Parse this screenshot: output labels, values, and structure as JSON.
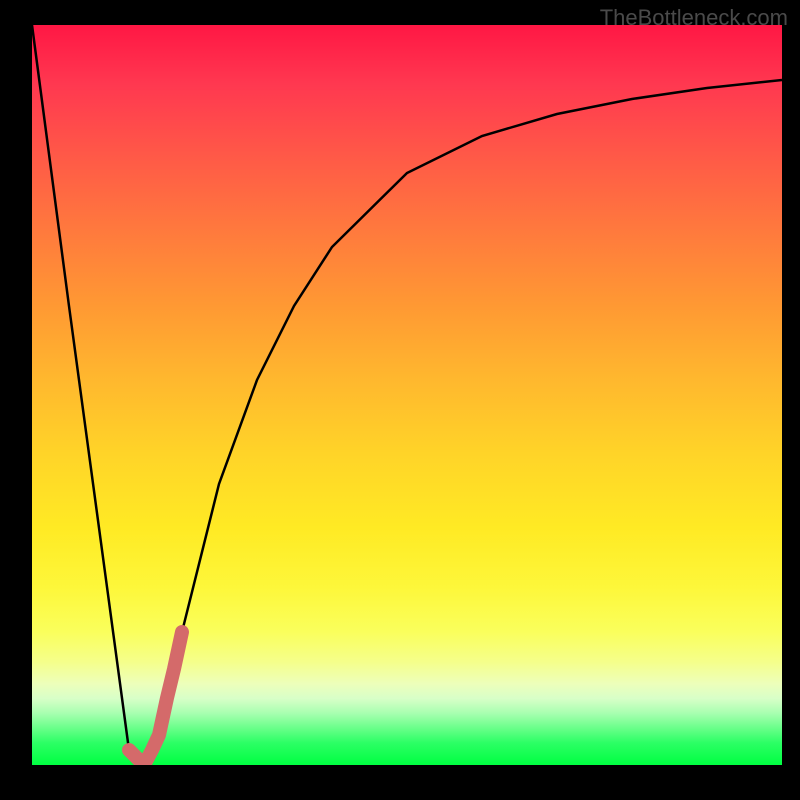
{
  "watermark": "TheBottleneck.com",
  "chart_data": {
    "type": "line",
    "title": "",
    "xlabel": "",
    "ylabel": "",
    "xlim": [
      0,
      100
    ],
    "ylim": [
      0,
      100
    ],
    "series": [
      {
        "name": "bottleneck-curve",
        "x": [
          0,
          5,
          10,
          13,
          15,
          17,
          20,
          25,
          30,
          35,
          40,
          50,
          60,
          70,
          80,
          90,
          100
        ],
        "y": [
          100,
          62,
          24,
          2,
          0,
          4,
          18,
          38,
          52,
          62,
          70,
          80,
          85,
          88,
          90,
          91.5,
          92.5
        ]
      }
    ],
    "highlight": {
      "name": "highlighted-range",
      "x": [
        13,
        14,
        15,
        16,
        17,
        18,
        19,
        20
      ],
      "y": [
        2,
        1,
        0,
        2,
        4,
        9,
        13,
        18
      ]
    },
    "background_gradient": {
      "top_color": "#ff1744",
      "bottom_color": "#00ff41",
      "type": "red-to-green"
    }
  }
}
